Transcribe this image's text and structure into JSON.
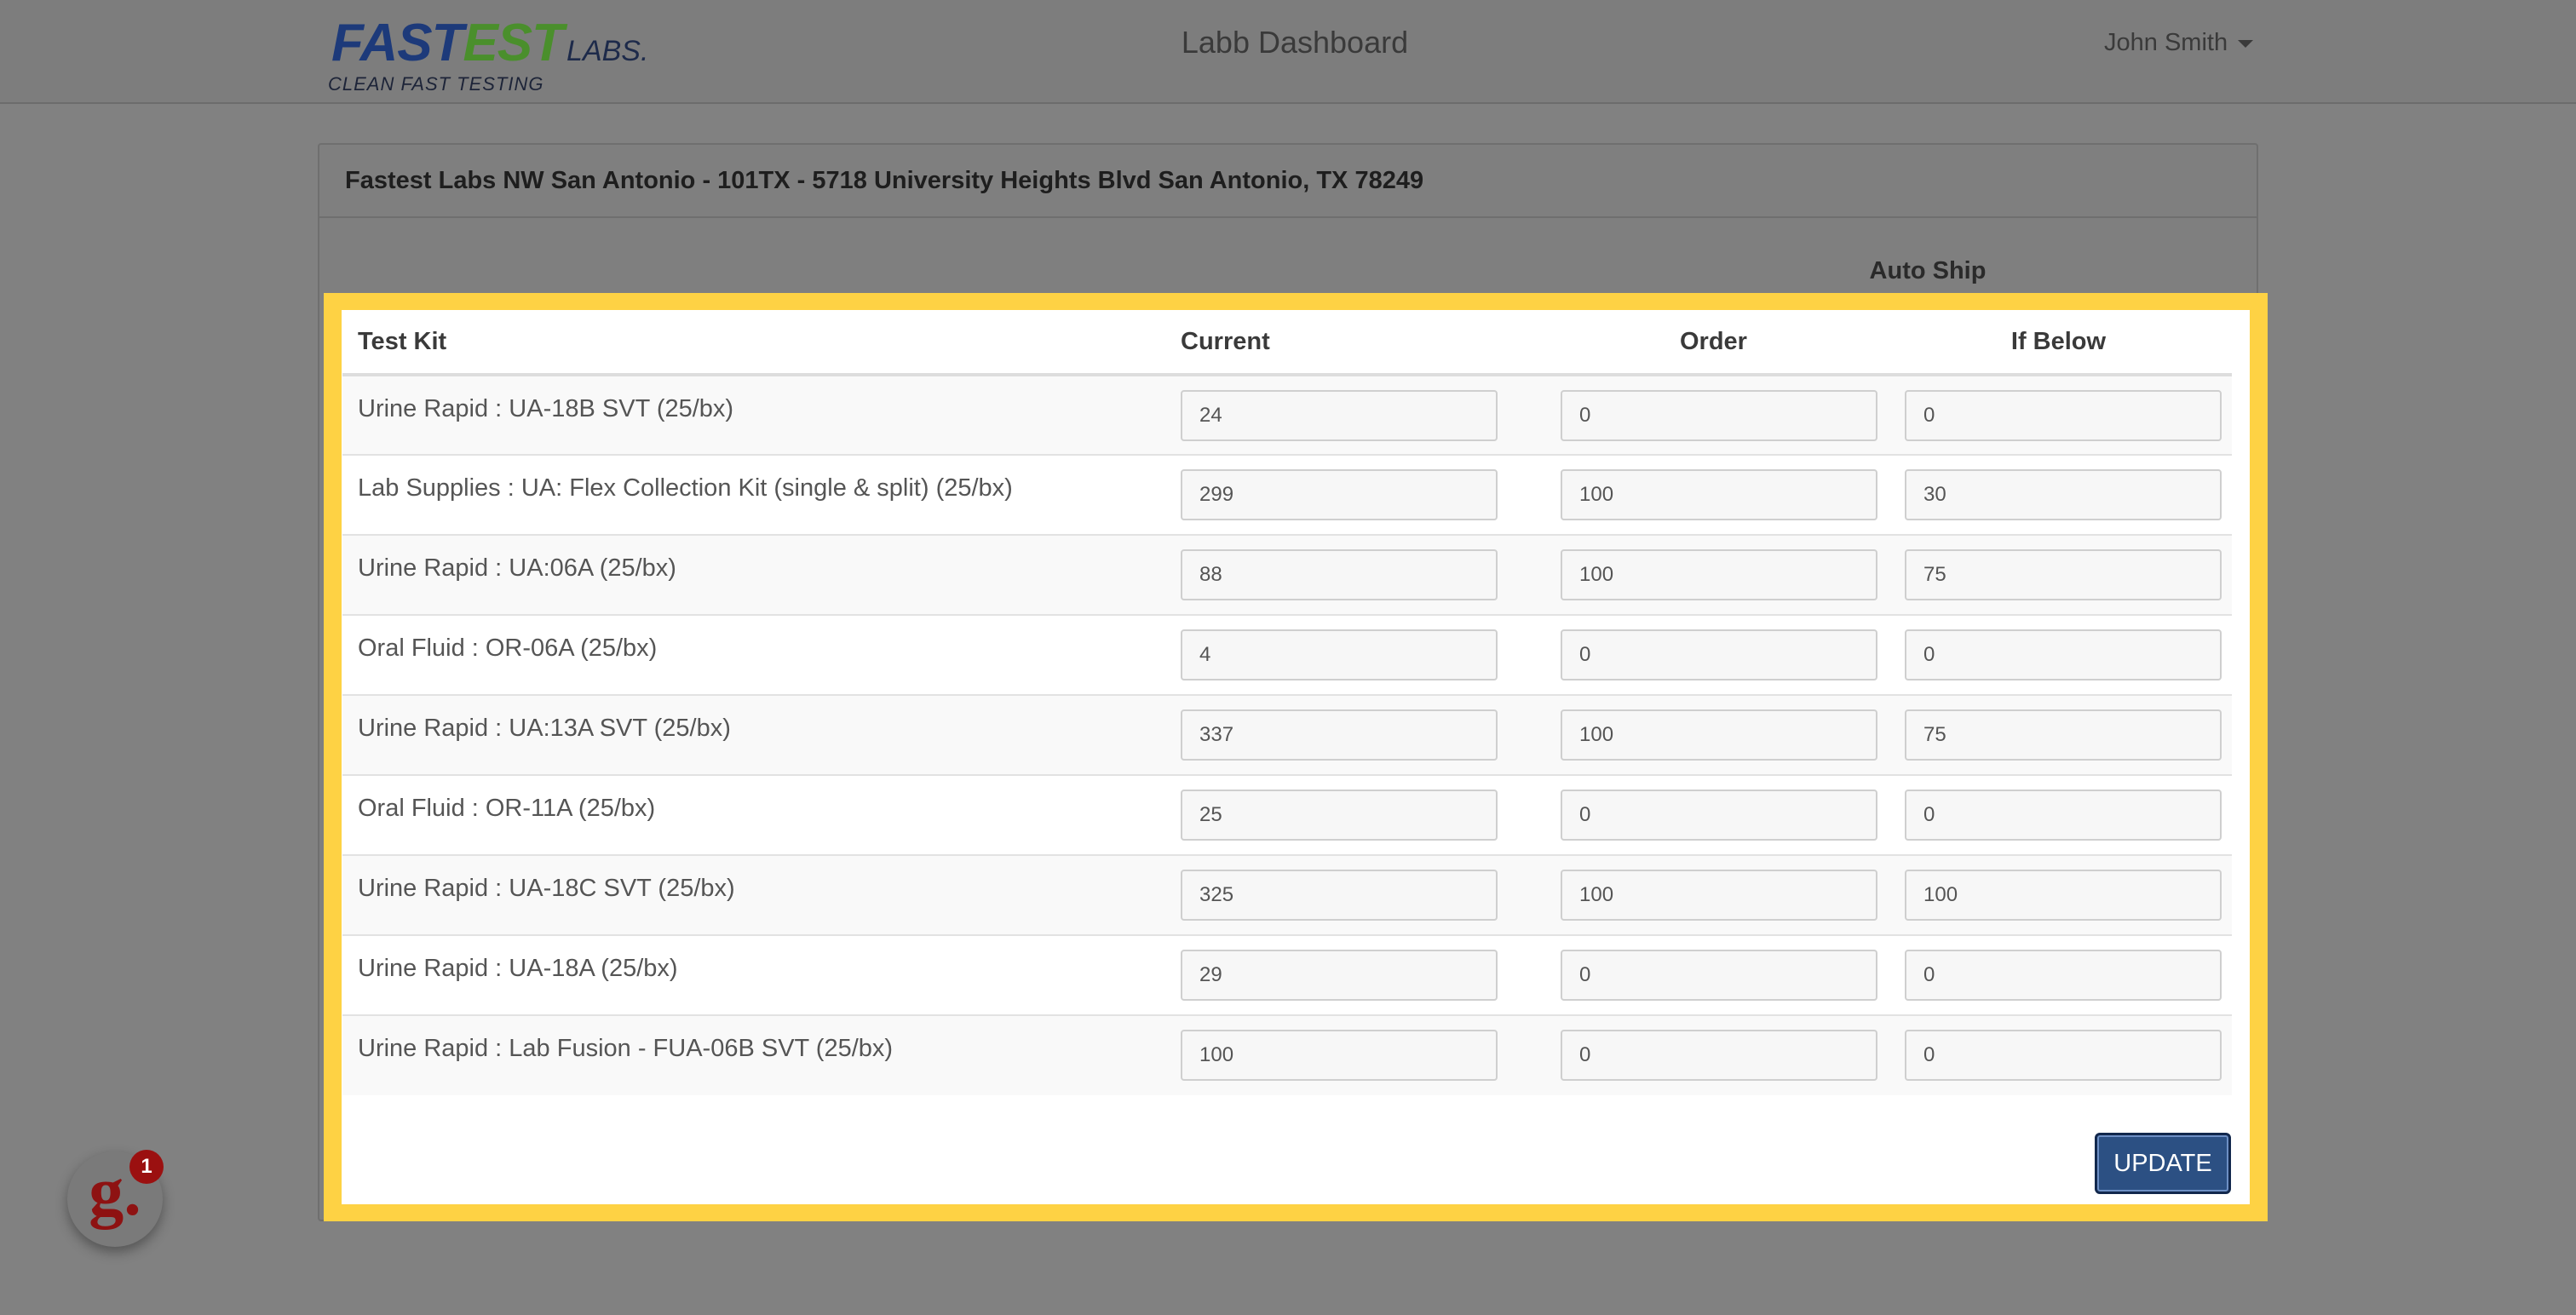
{
  "navbar": {
    "logo": {
      "word_part1": "FAST",
      "word_part2": "EST",
      "labs": "LABS.",
      "tagline": "CLEAN FAST TESTING"
    },
    "title": "Labb Dashboard",
    "user_name": "John Smith"
  },
  "panel": {
    "heading": "Fastest Labs NW San Antonio - 101TX - 5718 University Heights Blvd San Antonio, TX 78249",
    "autoship_label": "Auto Ship"
  },
  "table": {
    "headers": {
      "test_kit": "Test Kit",
      "current": "Current",
      "order": "Order",
      "if_below": "If Below"
    },
    "rows": [
      {
        "name": "Urine Rapid : UA-18B SVT (25/bx)",
        "current": "24",
        "order": "0",
        "if_below": "0"
      },
      {
        "name": "Lab Supplies : UA: Flex Collection Kit (single & split) (25/bx)",
        "current": "299",
        "order": "100",
        "if_below": "30"
      },
      {
        "name": "Urine Rapid : UA:06A (25/bx)",
        "current": "88",
        "order": "100",
        "if_below": "75"
      },
      {
        "name": "Oral Fluid : OR-06A (25/bx)",
        "current": "4",
        "order": "0",
        "if_below": "0"
      },
      {
        "name": "Urine Rapid : UA:13A SVT (25/bx)",
        "current": "337",
        "order": "100",
        "if_below": "75"
      },
      {
        "name": "Oral Fluid : OR-11A (25/bx)",
        "current": "25",
        "order": "0",
        "if_below": "0"
      },
      {
        "name": "Urine Rapid : UA-18C SVT (25/bx)",
        "current": "325",
        "order": "100",
        "if_below": "100"
      },
      {
        "name": "Urine Rapid : UA-18A (25/bx)",
        "current": "29",
        "order": "0",
        "if_below": "0"
      },
      {
        "name": "Urine Rapid : Lab Fusion - FUA-06B SVT (25/bx)",
        "current": "100",
        "order": "0",
        "if_below": "0"
      }
    ]
  },
  "actions": {
    "update_label": "UPDATE"
  },
  "help_widget": {
    "letter": "g.",
    "badge_count": "1"
  },
  "colors": {
    "highlight": "#fed244",
    "primary_button": "#2c5083",
    "logo_blue": "#1d3a7a",
    "logo_green": "#4a8f2c"
  }
}
